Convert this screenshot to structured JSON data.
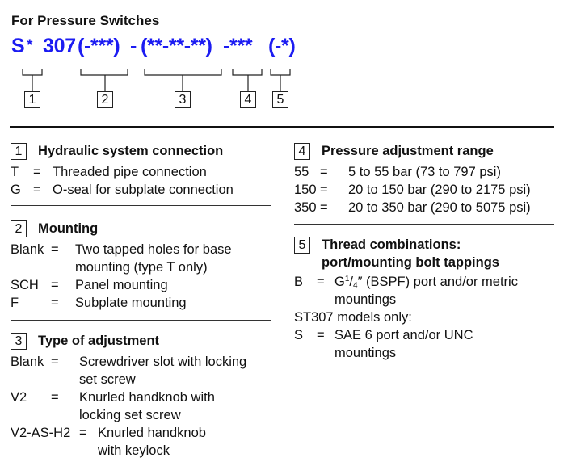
{
  "header": {
    "title": "For Pressure Switches",
    "code_parts": [
      "S",
      "*",
      "307",
      "(-***)",
      "-",
      "(**-**-**)",
      "-***",
      "(-*)"
    ],
    "code_color": "#1c1cf2",
    "callouts": [
      "1",
      "2",
      "3",
      "4",
      "5"
    ]
  },
  "sections": {
    "s1": {
      "number": "1",
      "heading": "Hydraulic system connection",
      "rows": [
        {
          "code": "T",
          "eq": "=",
          "desc": "Threaded pipe connection"
        },
        {
          "code": "G",
          "eq": "=",
          "desc": "O-seal for subplate connection"
        }
      ]
    },
    "s2": {
      "number": "2",
      "heading": "Mounting",
      "rows": [
        {
          "code": "Blank",
          "eq": "=",
          "desc": "Two tapped holes for base",
          "desc2": "mounting (type T only)"
        },
        {
          "code": "SCH",
          "eq": "=",
          "desc": "Panel mounting"
        },
        {
          "code": "F",
          "eq": "=",
          "desc": "Subplate mounting"
        }
      ]
    },
    "s3": {
      "number": "3",
      "heading": "Type of adjustment",
      "rows": [
        {
          "code": "Blank",
          "eq": "=",
          "desc": "Screwdriver slot with locking",
          "desc2": "set screw"
        },
        {
          "code": "V2",
          "eq": "=",
          "desc": "Knurled handknob with",
          "desc2": "locking set screw"
        },
        {
          "code": "V2-AS-H2",
          "eq": "=",
          "desc": "Knurled handknob",
          "desc2": "with keylock"
        }
      ]
    },
    "s4": {
      "number": "4",
      "heading": "Pressure adjustment range",
      "rows": [
        {
          "code": "55",
          "eq": "=",
          "desc": "5 to 55 bar (73 to 797 psi)"
        },
        {
          "code": "150",
          "eq": "=",
          "desc": "20 to 150 bar (290 to 2175 psi)"
        },
        {
          "code": "350",
          "eq": "=",
          "desc": "20 to 350 bar (290 to 5075 psi)"
        }
      ]
    },
    "s5": {
      "number": "5",
      "heading": "Thread combinations:",
      "heading2": "port/mounting bolt tappings",
      "rows": [
        {
          "code": "B",
          "eq": "=",
          "desc_pre": "G",
          "sup": "1",
          "slash": "/",
          "sub": "4",
          "desc_post": "″ (BSPF) port and/or metric",
          "desc2": "mountings"
        },
        {
          "note": "ST307 models only:"
        },
        {
          "code": "S",
          "eq": "=",
          "desc": "SAE 6 port and/or UNC",
          "desc2": "mountings"
        }
      ]
    }
  }
}
